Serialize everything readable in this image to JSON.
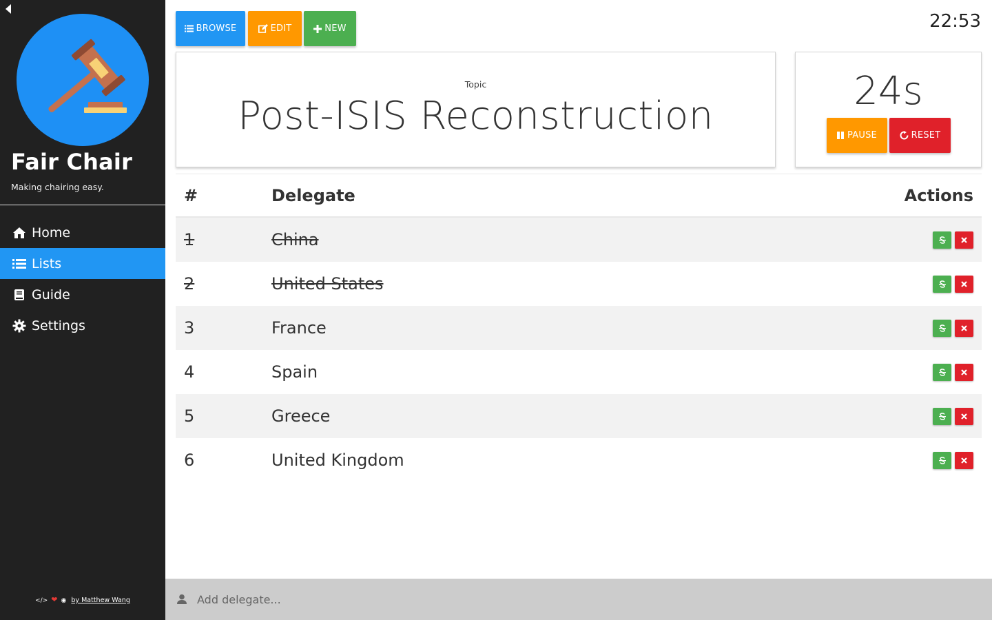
{
  "sidebar": {
    "title": "Fair Chair",
    "tagline": "Making chairing easy.",
    "items": [
      {
        "label": "Home",
        "icon": "home-icon"
      },
      {
        "label": "Lists",
        "icon": "list-icon",
        "active": true
      },
      {
        "label": "Guide",
        "icon": "book-icon"
      },
      {
        "label": "Settings",
        "icon": "gear-icon"
      }
    ],
    "footer": {
      "author_link": "by Matthew Wang"
    }
  },
  "toolbar": {
    "browse_label": "BROWSE",
    "edit_label": "EDIT",
    "new_label": "NEW"
  },
  "clock": "22:53",
  "topic": {
    "label": "Topic",
    "title": "Post-ISIS Reconstruction"
  },
  "timer": {
    "value": "24s",
    "pause_label": "PAUSE",
    "reset_label": "RESET"
  },
  "table": {
    "headers": {
      "num": "#",
      "delegate": "Delegate",
      "actions": "Actions"
    },
    "rows": [
      {
        "num": "1",
        "delegate": "China",
        "struck": true
      },
      {
        "num": "2",
        "delegate": "United States",
        "struck": true
      },
      {
        "num": "3",
        "delegate": "France",
        "struck": false
      },
      {
        "num": "4",
        "delegate": "Spain",
        "struck": false
      },
      {
        "num": "5",
        "delegate": "Greece",
        "struck": false
      },
      {
        "num": "6",
        "delegate": "United Kingdom",
        "struck": false
      }
    ]
  },
  "add_delegate": {
    "placeholder": "Add delegate..."
  },
  "colors": {
    "sidebar_bg": "#212121",
    "primary_blue": "#2196f3",
    "orange": "#ff9800",
    "green": "#4caf50",
    "red": "#e0212a",
    "logo_blue": "#1e90f5"
  }
}
